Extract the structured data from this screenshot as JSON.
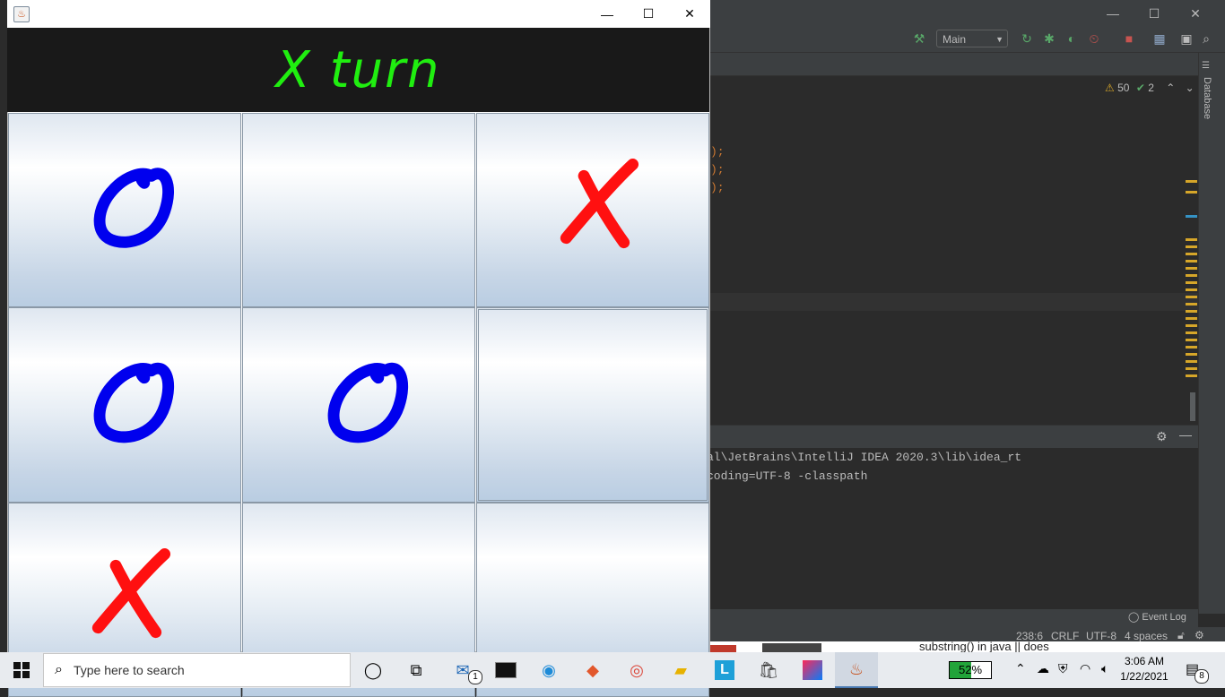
{
  "game_window": {
    "title": "",
    "minimize": "—",
    "maximize": "☐",
    "close": "✕",
    "turn_label": "X turn",
    "mark_colors": {
      "X": "#ff1010",
      "O": "#0000ee"
    },
    "board": [
      [
        "O",
        "",
        "X"
      ],
      [
        "O",
        "O",
        ""
      ],
      [
        "X",
        "",
        ""
      ]
    ]
  },
  "ide": {
    "run_config": "Main",
    "right_panel_label": "Database",
    "inspections": {
      "warnings": "50",
      "weak_warnings": "2"
    },
    "console_lines": [
      "al\\JetBrains\\IntelliJ IDEA 2020.3\\lib\\idea_rt",
      "coding=UTF-8 -classpath"
    ],
    "code_fragments": [
      ");",
      ");",
      ");"
    ],
    "status": {
      "event_log": "Event Log",
      "position": "238:6",
      "line_sep": "CRLF",
      "encoding": "UTF-8",
      "indent": "4 spaces"
    },
    "background_browser_snippet": "substring() in java || does"
  },
  "taskbar": {
    "search_placeholder": "Type here to search",
    "mail_badge": "1",
    "battery": "52%",
    "time": "3:06 AM",
    "date": "1/22/2021",
    "notification_count": "8"
  }
}
